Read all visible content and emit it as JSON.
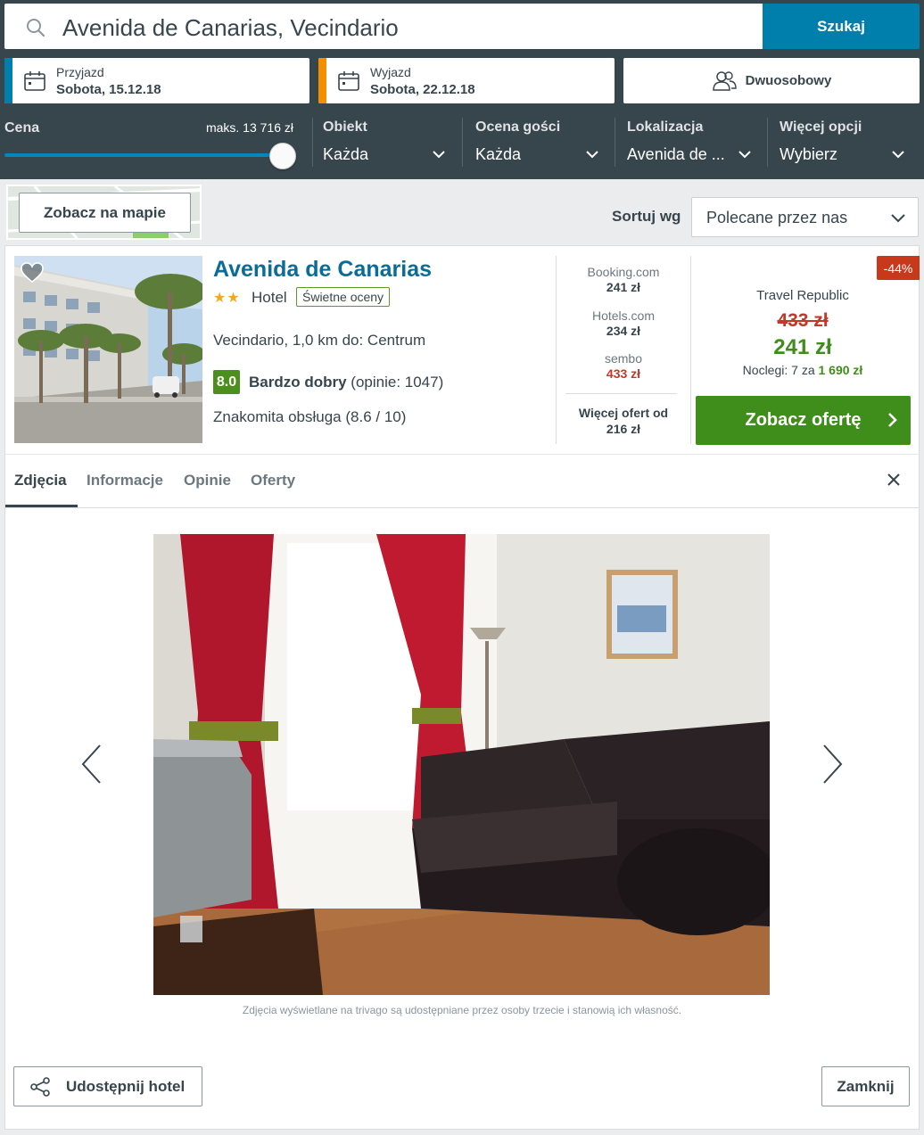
{
  "search": {
    "value": "Avenida de Canarias, Vecindario",
    "button_label": "Szukaj"
  },
  "dates": {
    "checkin_label": "Przyjazd",
    "checkin_value": "Sobota, 15.12.18",
    "checkout_label": "Wyjazd",
    "checkout_value": "Sobota, 22.12.18"
  },
  "room": {
    "label": "Dwuosobowy"
  },
  "filters": {
    "price_label": "Cena",
    "price_max": "maks. 13 716 zł",
    "price_slider_fraction": 1.0,
    "items": [
      {
        "title": "Obiekt",
        "value": "Każda"
      },
      {
        "title": "Ocena gości",
        "value": "Każda"
      },
      {
        "title": "Lokalizacja",
        "value": "Avenida de ..."
      },
      {
        "title": "Więcej opcji",
        "value": "Wybierz"
      }
    ]
  },
  "toolbar": {
    "map_button": "Zobacz na mapie",
    "sort_label": "Sortuj wg",
    "sort_value": "Polecane przez nas"
  },
  "hotel": {
    "name": "Avenida de Canarias",
    "stars": "★★",
    "type": "Hotel",
    "badge": "Świetne oceny",
    "location": "Vecindario, 1,0 km do: Centrum",
    "rating_value": "8.0",
    "rating_word": "Bardzo dobry",
    "rating_reviews": "(opinie: 1047)",
    "service": "Znakomita obsługa (8.6 / 10)"
  },
  "other_offers": [
    {
      "site": "Booking.com",
      "price": "241 zł"
    },
    {
      "site": "Hotels.com",
      "price": "234 zł"
    },
    {
      "site": "sembo",
      "price": "433 zł"
    }
  ],
  "more_offers": {
    "line1": "Więcej ofert od",
    "line2": "216 zł"
  },
  "best_offer": {
    "discount": "-44%",
    "site": "Travel Republic",
    "old_price": "433 zł",
    "new_price": "241 zł",
    "nights_prefix": "Noclegi: 7 za ",
    "nights_total": "1 690 zł",
    "button": "Zobacz ofertę"
  },
  "tabs": [
    {
      "label": "Zdjęcia"
    },
    {
      "label": "Informacje"
    },
    {
      "label": "Opinie"
    },
    {
      "label": "Oferty"
    }
  ],
  "gallery": {
    "credit": "Zdjęcia wyświetlane na trivago są udostępniane przez osoby trzecie i stanowią ich własność."
  },
  "footer": {
    "share_button": "Udostępnij hotel",
    "close_button": "Zamknij"
  },
  "colors": {
    "header_bg": "#37454d",
    "search_button": "#007fad",
    "checkin_accent": "#007fad",
    "checkout_accent": "#f48f00",
    "offer_green": "#3f8d1a",
    "discount_red": "#c8391b",
    "hotel_name": "#0a6d98"
  }
}
